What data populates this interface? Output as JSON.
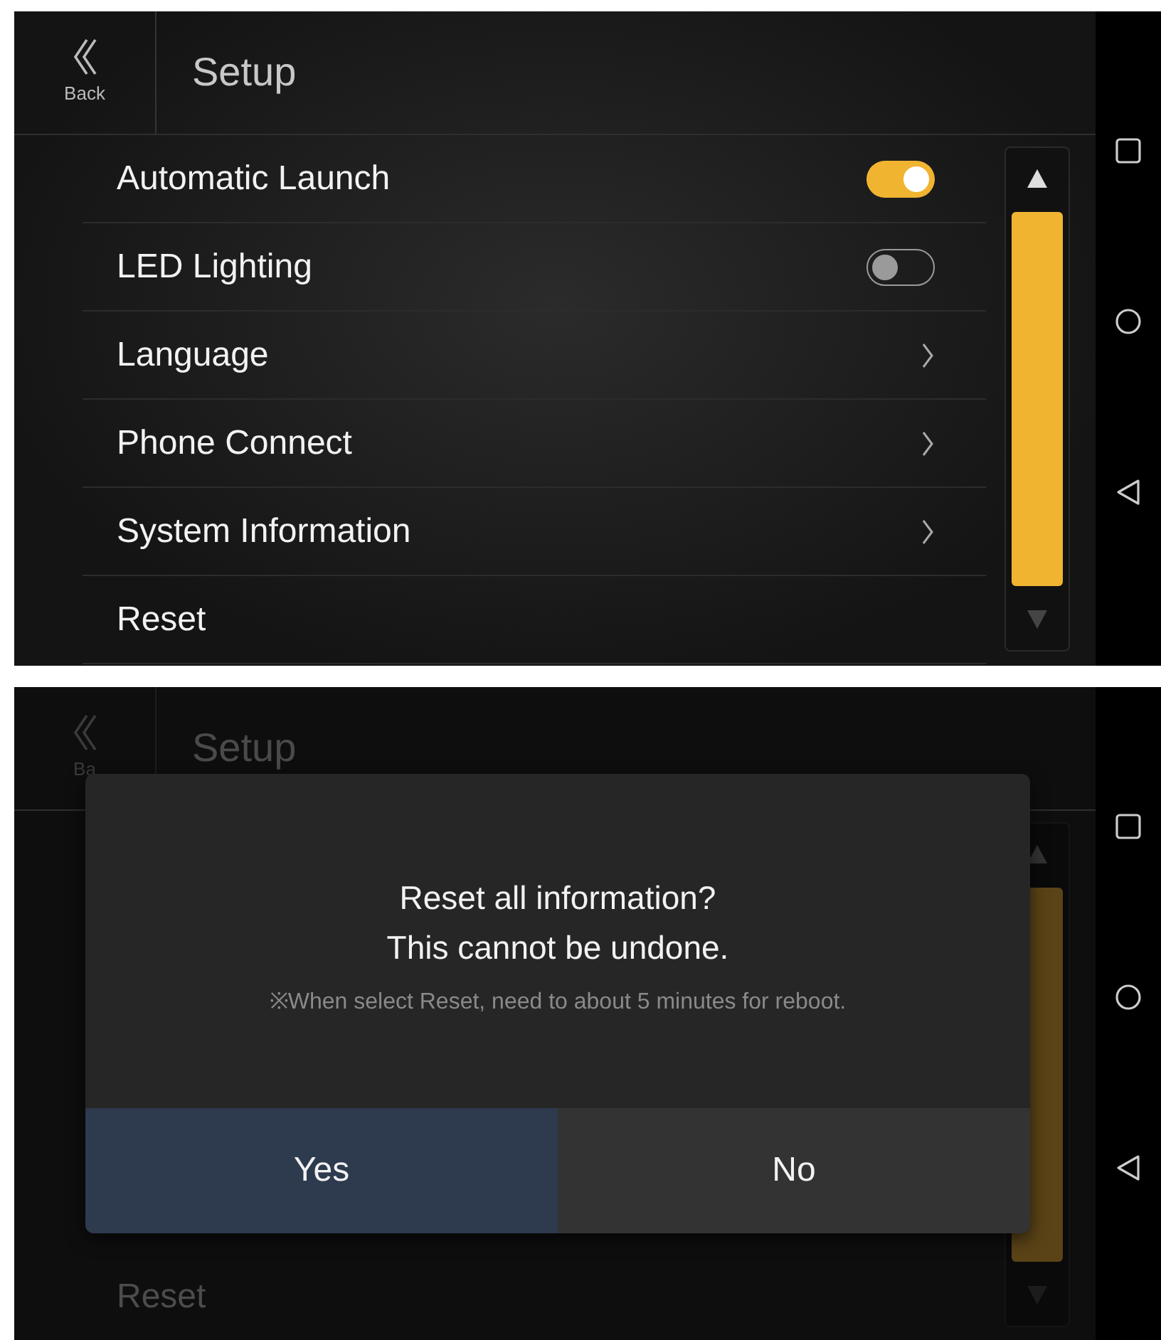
{
  "screens": [
    {
      "kind": "list",
      "header": {
        "back_label": "Back",
        "title": "Setup"
      },
      "items": [
        {
          "kind": "toggle",
          "label": "Automatic Launch",
          "on": true
        },
        {
          "kind": "toggle",
          "label": "LED Lighting",
          "on": false
        },
        {
          "kind": "link",
          "label": "Language"
        },
        {
          "kind": "link",
          "label": "Phone Connect"
        },
        {
          "kind": "link",
          "label": "System Information"
        },
        {
          "kind": "plain",
          "label": "Reset"
        }
      ]
    },
    {
      "kind": "dialog",
      "header": {
        "back_label": "Ba",
        "title": "Setup"
      },
      "items": [
        {
          "kind": "plain",
          "label": "Reset"
        }
      ],
      "dialog": {
        "title_lines": [
          "Reset all information?",
          "This cannot be undone."
        ],
        "note": "※When select Reset, need to about 5 minutes for reboot.",
        "buttons": [
          {
            "label": "Yes",
            "selected": true
          },
          {
            "label": "No",
            "selected": false
          }
        ]
      }
    }
  ]
}
